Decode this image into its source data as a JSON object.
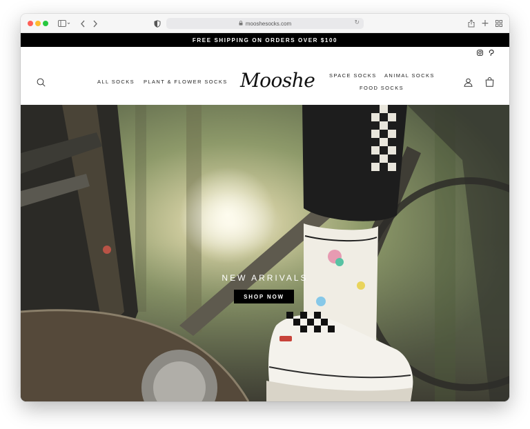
{
  "browser": {
    "url": "mooshesocks.com",
    "icons": [
      "sidebar-icon",
      "back-icon",
      "forward-icon",
      "shield-icon",
      "lock-icon",
      "reload-icon",
      "share-icon",
      "new-tab-icon",
      "tabs-overview-icon"
    ]
  },
  "announcement": {
    "text": "FREE SHIPPING ON ORDERS OVER $100"
  },
  "social": {
    "icons": [
      "instagram-icon",
      "pinterest-icon"
    ]
  },
  "header": {
    "logo": "Mooshe",
    "nav_left": [
      "ALL SOCKS",
      "PLANT & FLOWER SOCKS"
    ],
    "nav_right": [
      "SPACE SOCKS",
      "ANIMAL SOCKS",
      "FOOD SOCKS"
    ],
    "icons": [
      "search-icon",
      "account-icon",
      "cart-icon"
    ]
  },
  "hero": {
    "title": "NEW ARRIVALS",
    "button": "SHOP NOW"
  }
}
